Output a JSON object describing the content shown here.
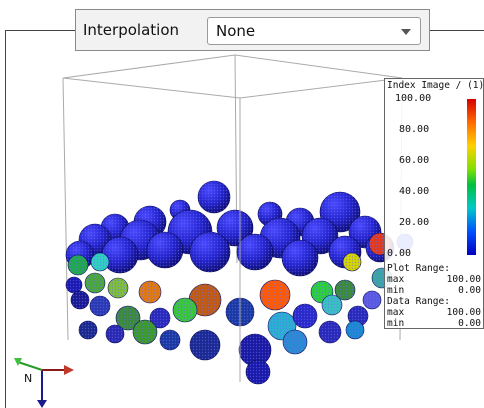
{
  "toolbar": {
    "interpolation_label": "Interpolation",
    "interpolation_value": "None",
    "chevron_icon": "chevron-down-icon"
  },
  "legend": {
    "title": "Index Image / (1)",
    "ticks": [
      "100.00",
      "80.00",
      "60.00",
      "40.00",
      "20.00",
      "0.00"
    ],
    "plot_range": {
      "label": "Plot Range:",
      "max_key": "max",
      "max_value": "100.00",
      "min_key": "min",
      "min_value": "0.00"
    },
    "data_range": {
      "label": "Data Range:",
      "max_key": "max",
      "max_value": "100.00",
      "min_key": "min",
      "min_value": "0.00"
    },
    "colors": {
      "high": "#d40000",
      "mid": "#00c040",
      "low": "#0000c0"
    }
  },
  "triad": {
    "axis_label": "N",
    "icon": "axis-triad-icon"
  },
  "colors": {
    "particle_dark": "#1a1aa8",
    "particle_base": "#2b2bd6",
    "frame": "#444444"
  }
}
